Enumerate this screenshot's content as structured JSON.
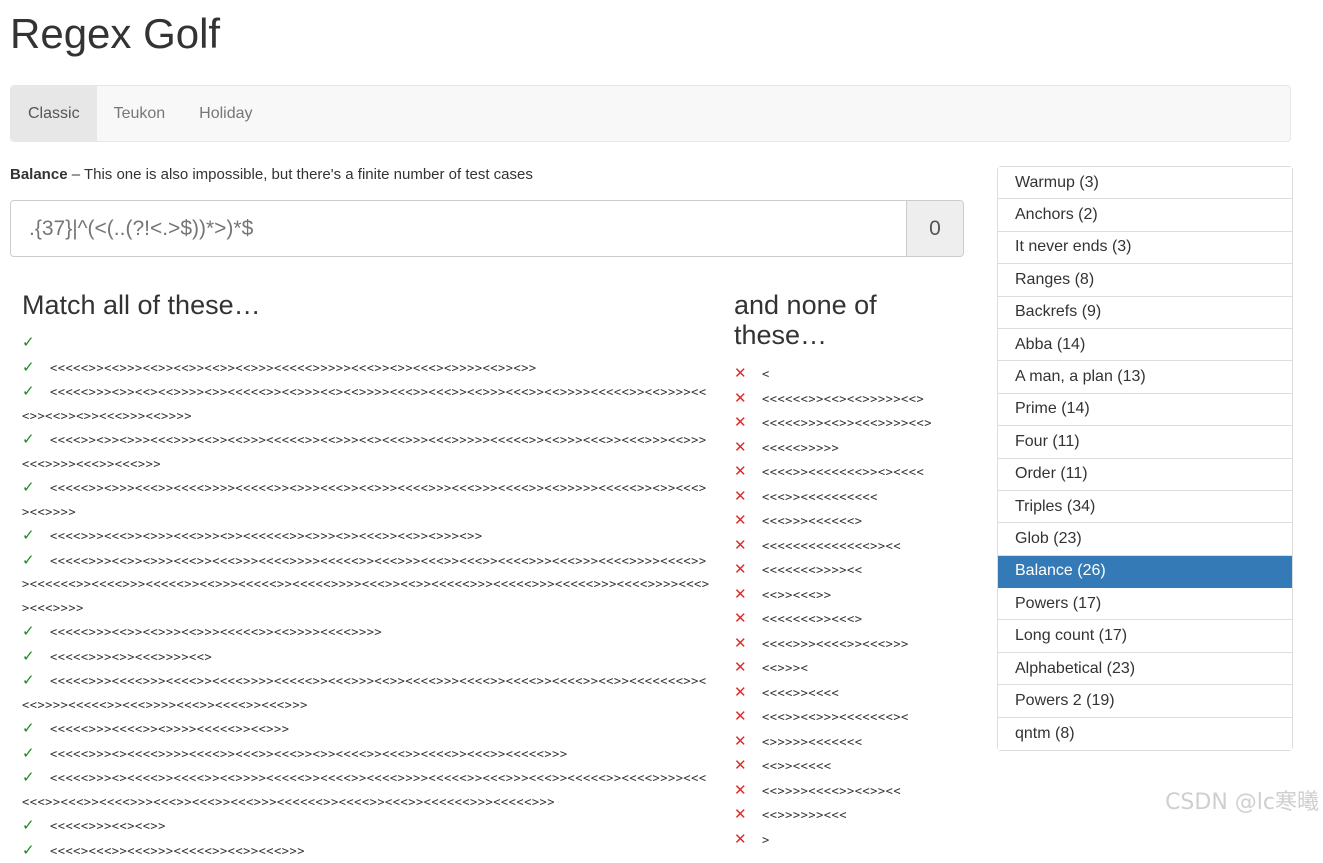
{
  "title": "Regex Golf",
  "nav": {
    "tabs": [
      {
        "label": "Classic",
        "active": true
      },
      {
        "label": "Teukon",
        "active": false
      },
      {
        "label": "Holiday",
        "active": false
      }
    ]
  },
  "puzzle": {
    "name": "Balance",
    "description": " – This one is also impossible, but there's a finite number of test cases",
    "regex_placeholder": ".{37}|^(<(..(?!<.>$))*>)*$",
    "score": "0"
  },
  "match": {
    "heading": "Match all of these…",
    "mark": "✓",
    "items": [
      "",
      "<<<<<>><<>>><<>><<>><<>><<>>><<<<<>>>>><<<>><>><<<><>>>><<>><>>",
      "<<<<<>>><>><<><<>>>><>><<<<<>><<>>><<><<>>>><<<>><<<>><<>>><<<>><<>>>><<<<<>><<>>>><<<>><<>><>><<<>>><<>>>>",
      "<<<<>><>><>>><<<>>><<>><<>>><<<<<>><<>>><<><<<>>><<<>>>>><<<<<>><<>>><<<>><<<>>><<>>><<<>>>><<<>><<<>>>",
      "<<<<<>><>>><<<>><<<<>>>><<<<<>><>>><<<>><<>>><<<<>>><<<>>><<<<>><<>>>>><<<<<>><>><<<>><<>>>>",
      "<<<<>>><<<>><>>><<<>>><>><<<<<<>><>>><>><<<>><<>><>>><>>",
      "<<<<<>>><<>><>>><<<>><<<>>><<<<>>>><<<<<>><<<>>><<<>><<<>><<<<>>><<<>>><<<<>>>><<<<>>><<<<<<>><<<<>>><<<<<>><<>>><<<<<>><<<<<>>>><<<>><<>><<<<<>>><<<<<>>><<<<<>>><<<<>>>><<<>><<<>>>>",
      "<<<<<>>><<>><<>>><<>>><<<<<>><<>>>><<<<>>>>",
      "<<<<<>>><>><<<>>>><<>",
      "<<<<<>>><<<<>>><<<<>><<<<>>>><<<<<>><<<>>><<>><<<<>>><<<<>><<<<>><<<<>><<>><<<<<<<>><<<>>>><<<<<>><<<>>>><<<>><<<<>><<<>>>",
      "<<<<<>>><<<<>><>>>><<<<<>><<>>>",
      "<<<<<>>><><<<<>>>><<<<>><<<>><<<>><>><<<<>><<<>><<<<>><<<>><<<<<>>>",
      "<<<<<>>><><<<<>><<<<>><<>>>><<<<<>><<<<>><<<<>>>><<<<<>><<<>>><<<>><<<<<>><<<<>>>><<<<<<>><<<>><<<<>>><<<>><<<>><<<>>><<<<<<>><<<<>><<<>><<<<<<>>><<<<<>>>",
      "<<<<<>>><<><<>>",
      "<<<<><<<>><<<>>><<<<<>><<>><<<>>>"
    ]
  },
  "none": {
    "heading": "and none of these…",
    "mark": "✕",
    "items": [
      "<",
      "<<<<<<>><<><<>>>>><<>",
      "<<<<<>>><<>><<<>>>><<>",
      "<<<<<>>>>>",
      "<<<<>><<<<<<<>><><<<<",
      "<<<>><<<<<<<<<<",
      "<<<>>><<<<<<>",
      "<<<<<<<<<<<<<<>><<",
      "<<<<<<<>>>><<",
      "<<>><<<>>",
      "<<<<<<<>><<<>",
      "<<<<>>><<<<>><<<>>>",
      "<<>>><",
      "<<<<>><<<<",
      "<<<>><<>>><<<<<<<><",
      "<>>>>><<<<<<<",
      "<<>><<<<<",
      "<<>>>><<<<>><<>><<",
      "<<>>>>>><<<",
      ">"
    ]
  },
  "sidebar": {
    "items": [
      {
        "label": "Warmup (3)",
        "active": false
      },
      {
        "label": "Anchors (2)",
        "active": false
      },
      {
        "label": "It never ends (3)",
        "active": false
      },
      {
        "label": "Ranges (8)",
        "active": false
      },
      {
        "label": "Backrefs (9)",
        "active": false
      },
      {
        "label": "Abba (14)",
        "active": false
      },
      {
        "label": "A man, a plan (13)",
        "active": false
      },
      {
        "label": "Prime (14)",
        "active": false
      },
      {
        "label": "Four (11)",
        "active": false
      },
      {
        "label": "Order (11)",
        "active": false
      },
      {
        "label": "Triples (34)",
        "active": false
      },
      {
        "label": "Glob (23)",
        "active": false
      },
      {
        "label": "Balance (26)",
        "active": true
      },
      {
        "label": "Powers (17)",
        "active": false
      },
      {
        "label": "Long count (17)",
        "active": false
      },
      {
        "label": "Alphabetical (23)",
        "active": false
      },
      {
        "label": "Powers 2 (19)",
        "active": false
      },
      {
        "label": "qntm (8)",
        "active": false
      }
    ]
  },
  "watermark": "CSDN @lc寒曦",
  "colors": {
    "active_sidebar": "#337ab7",
    "check": "#1a8a1a",
    "cross": "#d9302a"
  }
}
